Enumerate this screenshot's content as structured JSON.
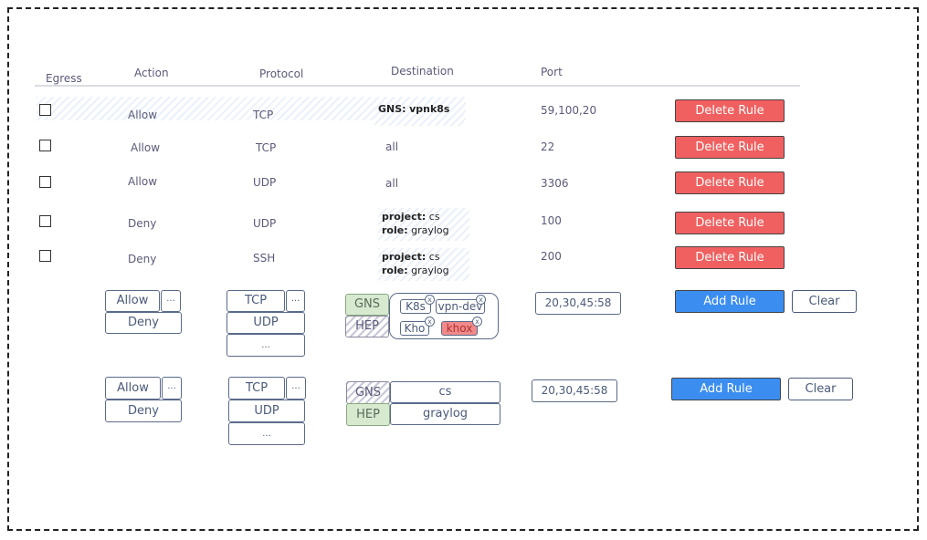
{
  "headers": {
    "egress": "Egress",
    "action": "Action",
    "protocol": "Protocol",
    "destination": "Destination",
    "port": "Port"
  },
  "rules": [
    {
      "action": "Allow",
      "protocol": "TCP",
      "dest_line1_key": "GNS:",
      "dest_line1_val": "vpnk8s",
      "dest_line2_key": "",
      "dest_line2_val": "",
      "port": "59,100,20",
      "delete_label": "Delete Rule"
    },
    {
      "action": "Allow",
      "protocol": "TCP",
      "dest_plain": "all",
      "port": "22",
      "delete_label": "Delete Rule"
    },
    {
      "action": "Allow",
      "protocol": "UDP",
      "dest_plain": "all",
      "port": "3306",
      "delete_label": "Delete Rule"
    },
    {
      "action": "Deny",
      "protocol": "UDP",
      "dest_line1_key": "project:",
      "dest_line1_val": "cs",
      "dest_line2_key": "role:",
      "dest_line2_val": "graylog",
      "port": "100",
      "delete_label": "Delete Rule"
    },
    {
      "action": "Deny",
      "protocol": "SSH",
      "dest_line1_key": "project:",
      "dest_line1_val": "cs",
      "dest_line2_key": "role:",
      "dest_line2_val": "graylog",
      "port": "200",
      "delete_label": "Delete Rule"
    }
  ],
  "editors": [
    {
      "action_options": [
        "Allow",
        "Deny"
      ],
      "action_more": "...",
      "protocol_options": [
        "TCP",
        "UDP"
      ],
      "protocol_more": "...",
      "protocol_more_row": "...",
      "dest_tabs": [
        "GNS",
        "HEP"
      ],
      "chips": [
        "K8s",
        "vpn-dev",
        "Kho",
        "khox"
      ],
      "port_value": "20,30,45:58",
      "add_label": "Add Rule",
      "clear_label": "Clear"
    },
    {
      "action_options": [
        "Allow",
        "Deny"
      ],
      "action_more": "...",
      "protocol_options": [
        "TCP",
        "UDP"
      ],
      "protocol_more": "...",
      "protocol_more_row": "...",
      "dest_tabs": [
        "GNS",
        "HEP"
      ],
      "dest_values": [
        "cs",
        "graylog"
      ],
      "port_value": "20,30,45:58",
      "add_label": "Add Rule",
      "clear_label": "Clear"
    }
  ],
  "colors": {
    "delete": "#f06060",
    "add": "#3b8ef0",
    "tag_green": "#d7ead0",
    "chip_red": "#f08a8a"
  }
}
